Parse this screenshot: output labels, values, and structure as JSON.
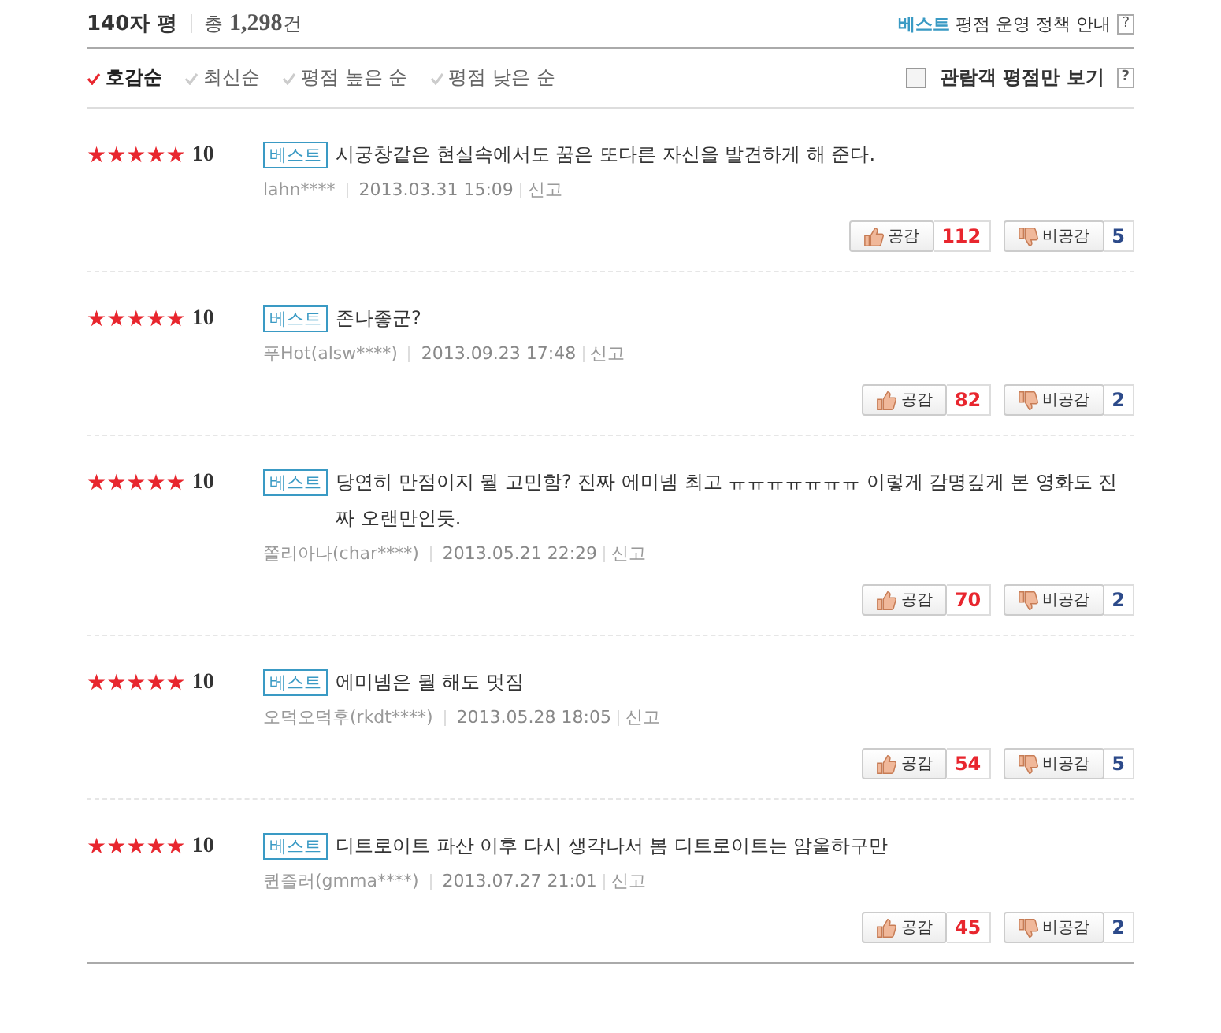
{
  "header": {
    "title": "140자 평",
    "total_prefix": "총",
    "total_count": "1,298",
    "total_suffix": "건",
    "policy_highlight": "베스트",
    "policy_text": "평점 운영 정책 안내",
    "policy_help": "?"
  },
  "sort_options": [
    {
      "label": "호감순",
      "selected": true
    },
    {
      "label": "최신순",
      "selected": false
    },
    {
      "label": "평점 높은 순",
      "selected": false
    },
    {
      "label": "평점 낮은 순",
      "selected": false
    }
  ],
  "audience_filter": {
    "label": "관람객 평점만 보기",
    "checked": false,
    "help": "?"
  },
  "reviews": [
    {
      "stars": 5,
      "score": "10",
      "badge": "베스트",
      "text": "시궁창같은 현실속에서도 꿈은 또다른 자신을 발견하게 해 준다.",
      "author": "lahn****",
      "date": "2013.03.31 15:09",
      "report": "신고",
      "like_label": "공감",
      "likes": "112",
      "dislike_label": "비공감",
      "dislikes": "5"
    },
    {
      "stars": 5,
      "score": "10",
      "badge": "베스트",
      "text": "존나좋군?",
      "author": "푸Hot(alsw****)",
      "date": "2013.09.23 17:48",
      "report": "신고",
      "like_label": "공감",
      "likes": "82",
      "dislike_label": "비공감",
      "dislikes": "2"
    },
    {
      "stars": 5,
      "score": "10",
      "badge": "베스트",
      "text": "당연히 만점이지 뭘 고민함? 진짜 에미넴 최고 ㅠㅠㅠㅠㅠㅠㅠ 이렇게 감명깊게 본 영화도 진짜 오랜만인듯.",
      "author": "쫄리아나(char****)",
      "date": "2013.05.21 22:29",
      "report": "신고",
      "like_label": "공감",
      "likes": "70",
      "dislike_label": "비공감",
      "dislikes": "2"
    },
    {
      "stars": 5,
      "score": "10",
      "badge": "베스트",
      "text": "에미넴은 뭘 해도 멋짐",
      "author": "오덕오덕후(rkdt****)",
      "date": "2013.05.28 18:05",
      "report": "신고",
      "like_label": "공감",
      "likes": "54",
      "dislike_label": "비공감",
      "dislikes": "5"
    },
    {
      "stars": 5,
      "score": "10",
      "badge": "베스트",
      "text": "디트로이트 파산 이후 다시 생각나서 봄 디트로이트는 암울하구만",
      "author": "퀸즐러(gmma****)",
      "date": "2013.07.27 21:01",
      "report": "신고",
      "like_label": "공감",
      "likes": "45",
      "dislike_label": "비공감",
      "dislikes": "2"
    }
  ]
}
